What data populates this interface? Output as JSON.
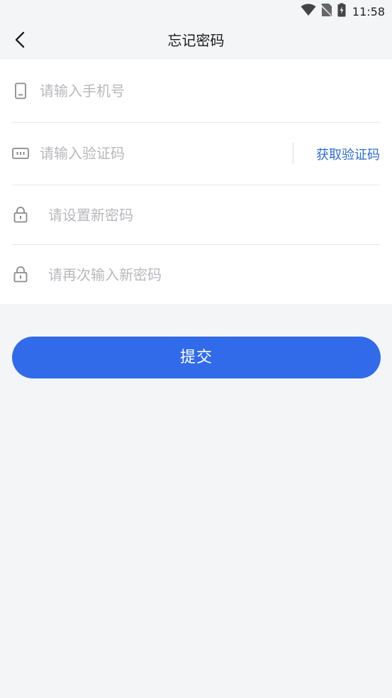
{
  "status_bar": {
    "time": "11:58"
  },
  "header": {
    "title": "忘记密码",
    "back_icon": "chevron-left-icon"
  },
  "form": {
    "phone": {
      "icon": "phone-icon",
      "placeholder": "请输入手机号",
      "value": ""
    },
    "code": {
      "icon": "verification-code-icon",
      "placeholder": "请输入验证码",
      "value": "",
      "send_button": "获取验证码"
    },
    "new_password": {
      "icon": "lock-icon",
      "placeholder": "请设置新密码",
      "value": ""
    },
    "confirm_password": {
      "icon": "lock-icon",
      "placeholder": "请再次输入新密码",
      "value": ""
    }
  },
  "submit": {
    "label": "提交"
  },
  "colors": {
    "accent": "#316bea",
    "link": "#2f6bd8",
    "background": "#f4f5f7",
    "placeholder": "#b8b8bd"
  }
}
